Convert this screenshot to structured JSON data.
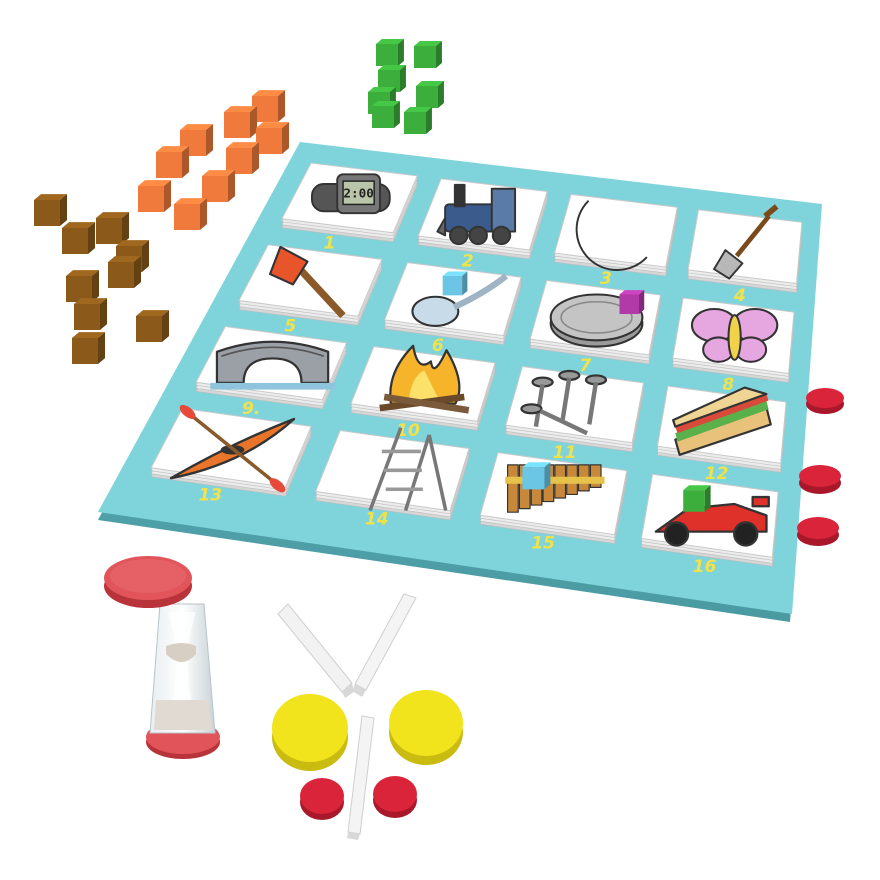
{
  "board": {
    "color": "#7fd3da",
    "cards": [
      {
        "number": "1",
        "picture": "wristwatch",
        "clock_text": "2:00"
      },
      {
        "number": "2",
        "picture": "steam-train"
      },
      {
        "number": "3",
        "picture": "crescent-moon"
      },
      {
        "number": "4",
        "picture": "shovel"
      },
      {
        "number": "5",
        "picture": "axe"
      },
      {
        "number": "6",
        "picture": "spoon",
        "marker": "blue-cube"
      },
      {
        "number": "7",
        "picture": "coin",
        "marker": "purple-cube"
      },
      {
        "number": "8",
        "picture": "butterfly"
      },
      {
        "number": "9.",
        "picture": "stone-bridge"
      },
      {
        "number": "10",
        "picture": "campfire"
      },
      {
        "number": "11",
        "picture": "nails"
      },
      {
        "number": "12",
        "picture": "sandwich"
      },
      {
        "number": "13",
        "picture": "kayak"
      },
      {
        "number": "14",
        "picture": "step-ladder"
      },
      {
        "number": "15",
        "picture": "pan-flute",
        "marker": "blue-cube"
      },
      {
        "number": "16",
        "picture": "race-car",
        "marker": "green-cube"
      }
    ]
  },
  "pieces": {
    "colors": {
      "orange_cube": "#f07a3c",
      "brown_cube": "#8b5a1a",
      "green_cube": "#3cae3c",
      "red_token": "#d9243a",
      "yellow_token": "#f2e41c",
      "blue_cube": "#6ac6e4",
      "purple_cube": "#b23aa8",
      "sand_timer_cap": "#e0545a"
    }
  }
}
